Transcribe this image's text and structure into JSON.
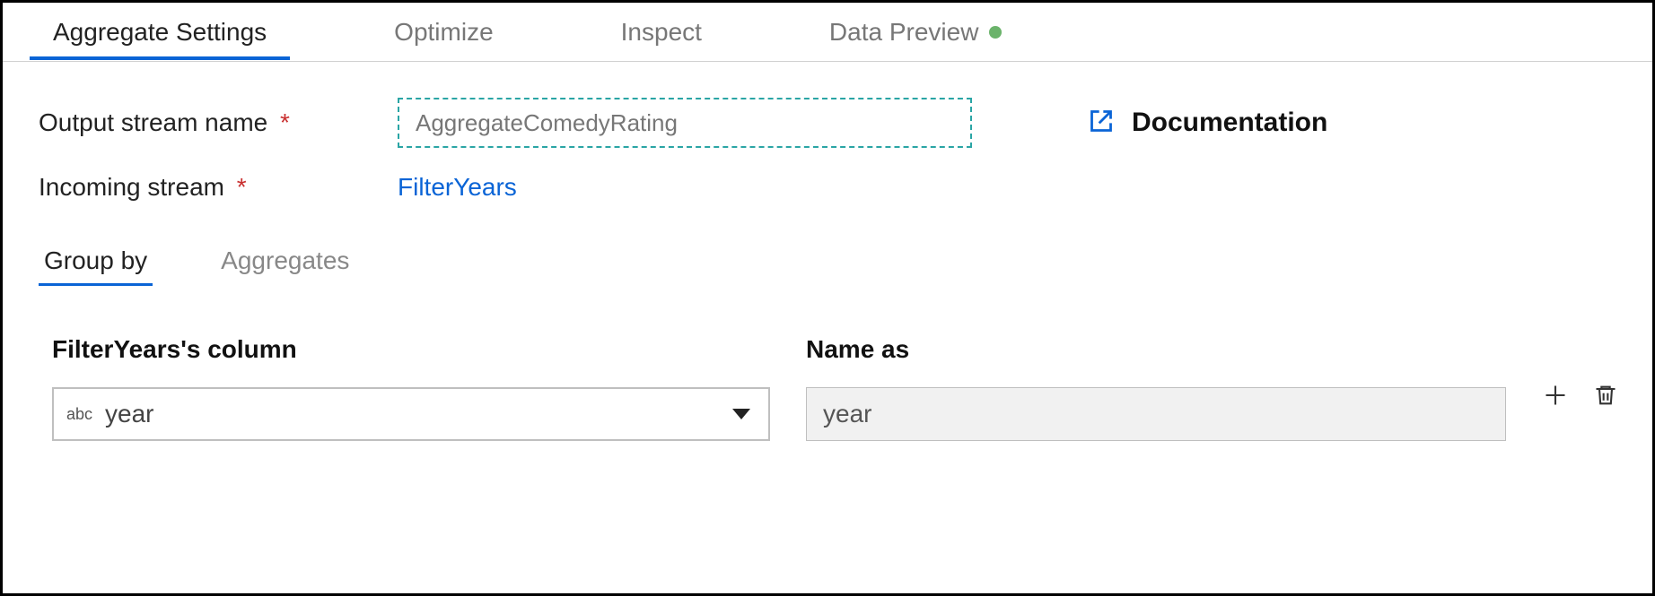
{
  "tabs": {
    "aggregate_settings": "Aggregate Settings",
    "optimize": "Optimize",
    "inspect": "Inspect",
    "data_preview": "Data Preview"
  },
  "form": {
    "output_stream_label": "Output stream name",
    "output_stream_value": "AggregateComedyRating",
    "incoming_stream_label": "Incoming stream",
    "incoming_stream_value": "FilterYears",
    "documentation_label": "Documentation"
  },
  "subtabs": {
    "group_by": "Group by",
    "aggregates": "Aggregates"
  },
  "group_by": {
    "column_header": "FilterYears's column",
    "name_header": "Name as",
    "rows": [
      {
        "type_badge": "abc",
        "column": "year",
        "name_as": "year"
      }
    ]
  }
}
